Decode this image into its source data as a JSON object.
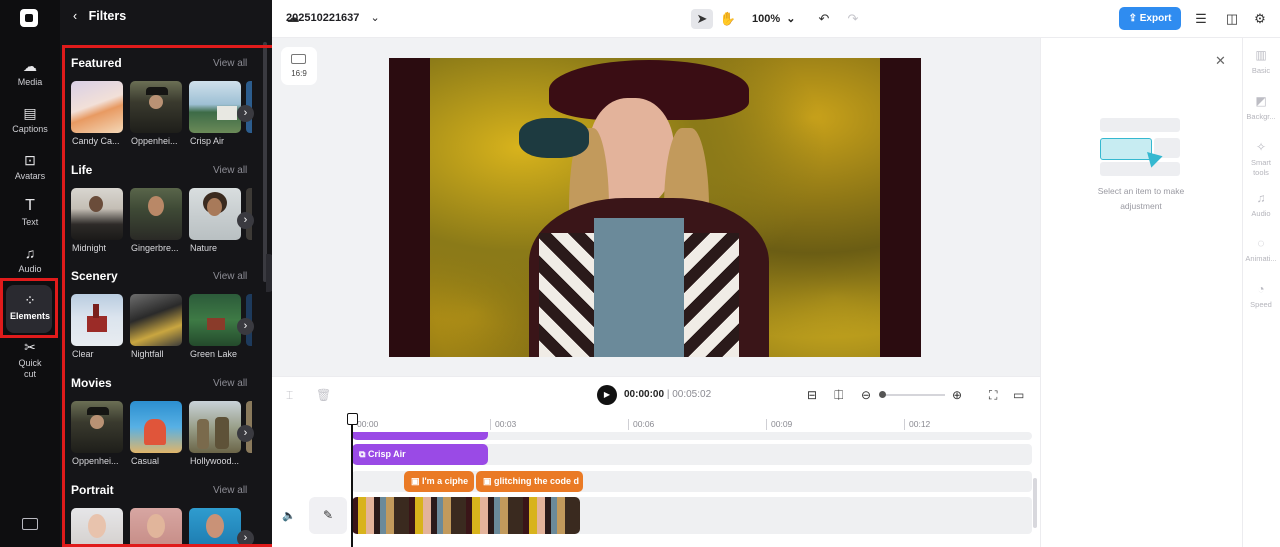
{
  "rail": {
    "items": [
      {
        "label": "Media",
        "icon": "cloud-upload-icon"
      },
      {
        "label": "Captions",
        "icon": "captions-icon"
      },
      {
        "label": "Avatars",
        "icon": "avatar-icon"
      },
      {
        "label": "Text",
        "icon": "text-icon"
      },
      {
        "label": "Audio",
        "icon": "music-note-icon"
      },
      {
        "label": "Elements",
        "icon": "elements-icon",
        "active": true
      },
      {
        "label": "Quick cut",
        "icon": "quick-cut-icon"
      }
    ]
  },
  "panel": {
    "title": "Filters",
    "view_all": "View all",
    "sections": [
      {
        "title": "Featured",
        "items": [
          "Candy Ca...",
          "Oppenhei...",
          "Crisp Air"
        ]
      },
      {
        "title": "Life",
        "items": [
          "Midnight",
          "Gingerbre...",
          "Nature"
        ]
      },
      {
        "title": "Scenery",
        "items": [
          "Clear",
          "Nightfall",
          "Green Lake"
        ]
      },
      {
        "title": "Movies",
        "items": [
          "Oppenhei...",
          "Casual",
          "Hollywood..."
        ]
      },
      {
        "title": "Portrait",
        "items": [
          "",
          "",
          ""
        ]
      }
    ]
  },
  "topbar": {
    "project_name": "202510221637",
    "zoom": "100%",
    "export_label": "Export"
  },
  "stage": {
    "aspect_ratio": "16:9"
  },
  "properties": {
    "empty_message": "Select an item to make adjustment",
    "tabs": [
      "Basic",
      "Backgr...",
      "Smart tools",
      "Audio",
      "Animati...",
      "Speed"
    ]
  },
  "timeline": {
    "current_time": "00:00:00",
    "total_time": "00:05:02",
    "ruler": [
      "00:00",
      "00:03",
      "00:06",
      "00:09",
      "00:12"
    ],
    "filter_clip": "Crisp Air",
    "text_clips": [
      "I'm a ciphe",
      "glitching the code d"
    ]
  },
  "colors": {
    "accent": "#2f8cf0",
    "highlight": "#e01b1b",
    "filter_clip": "#9a4ae6",
    "text_clip": "#ea7a25"
  }
}
